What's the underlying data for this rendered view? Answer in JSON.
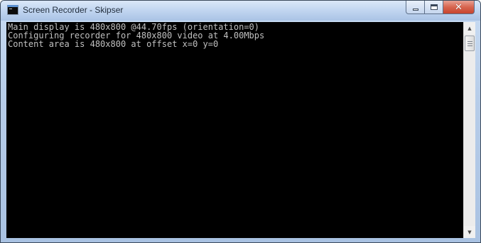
{
  "window": {
    "title": "Screen Recorder - Skipser",
    "icon": "console-window-icon",
    "close_color": "#c7432d"
  },
  "caption_buttons": {
    "minimize_icon": "minimize-icon",
    "maximize_icon": "maximize-icon",
    "close_icon": "close-icon",
    "close_glyph": "✕"
  },
  "console": {
    "background": "#000000",
    "text_color": "#c0c0c0",
    "lines": [
      "Main display is 480x800 @44.70fps (orientation=0)",
      "Configuring recorder for 480x800 video at 4.00Mbps",
      "Content area is 480x800 at offset x=0 y=0"
    ]
  },
  "scrollbar": {
    "up_glyph": "▲",
    "down_glyph": "▼"
  }
}
